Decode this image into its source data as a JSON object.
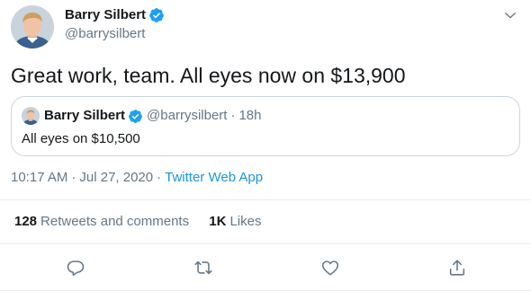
{
  "tweet": {
    "author": {
      "display_name": "Barry Silbert",
      "handle": "@barrysilbert",
      "verified": true
    },
    "text": "Great work, team. All eyes now on $13,900",
    "quoted": {
      "display_name": "Barry Silbert",
      "handle": "@barrysilbert",
      "separator": "·",
      "time": "18h",
      "text": "All eyes on $10,500"
    },
    "meta": {
      "time": "10:17 AM",
      "separator1": "·",
      "date": "Jul 27, 2020",
      "separator2": "·",
      "app": "Twitter Web App"
    },
    "stats": {
      "retweets_count": "128",
      "retweets_label": "Retweets and comments",
      "likes_count": "1K",
      "likes_label": "Likes"
    },
    "actions": [
      "reply-icon",
      "retweet-icon",
      "like-icon",
      "share-icon"
    ]
  },
  "colors": {
    "accent": "#1da1f2",
    "link": "#1b95e0",
    "secondary_text": "#657786",
    "border": "#ccd6dd",
    "divider": "#e6ecf0",
    "text": "#14171a"
  }
}
